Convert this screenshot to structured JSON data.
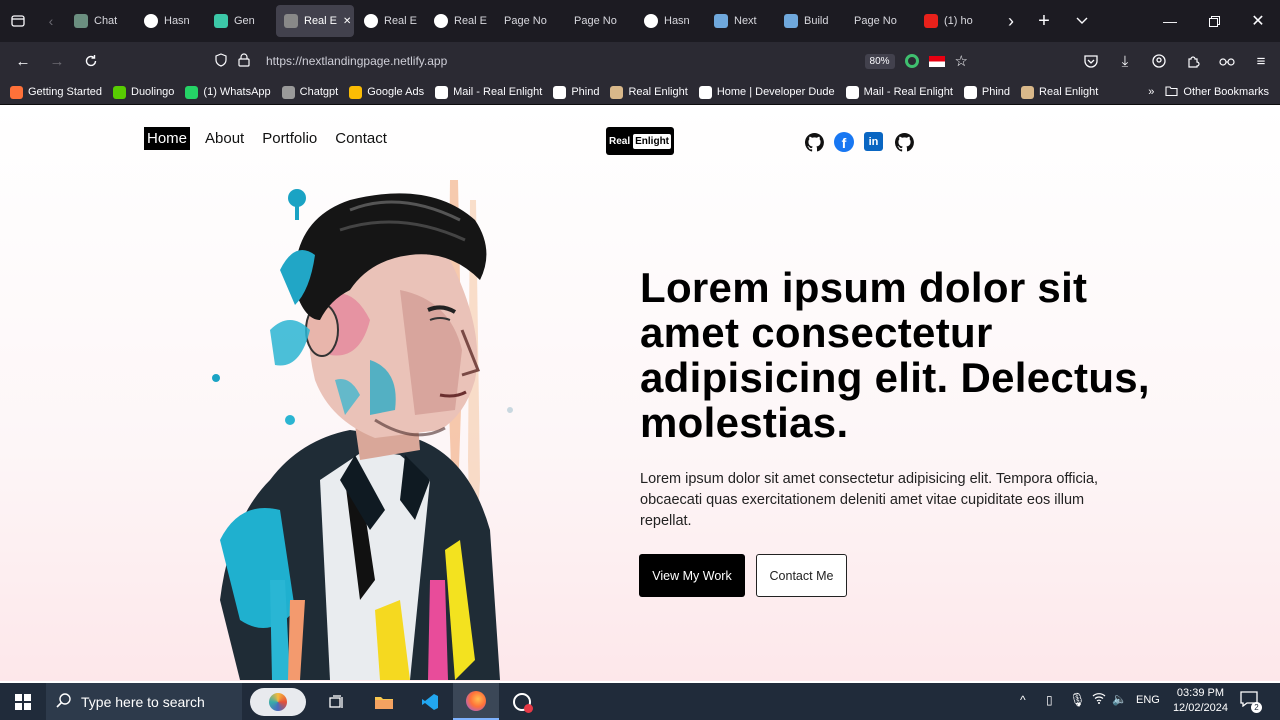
{
  "browser": {
    "tabs": [
      {
        "label": "Chat",
        "favicon_color": "#6b8f80"
      },
      {
        "label": "Hasn",
        "favicon_color": "#ffffff"
      },
      {
        "label": "Gen",
        "favicon_color": "#3cc8a8"
      },
      {
        "label": "Real E",
        "favicon_color": "#888888",
        "active": true
      },
      {
        "label": "Real E",
        "favicon_color": "#ffffff"
      },
      {
        "label": "Real E",
        "favicon_color": "#ffffff"
      },
      {
        "label": "Page No",
        "favicon_color": ""
      },
      {
        "label": "Page No",
        "favicon_color": ""
      },
      {
        "label": "Hasn",
        "favicon_color": "#ffffff"
      },
      {
        "label": "Next",
        "favicon_color": "#6fa8dc"
      },
      {
        "label": "Build",
        "favicon_color": "#6fa8dc"
      },
      {
        "label": "Page No",
        "favicon_color": ""
      },
      {
        "label": "(1) ho",
        "favicon_color": "#e8211b"
      }
    ],
    "url": "https://nextlandingpage.netlify.app",
    "zoom": "80%",
    "bookmarks": [
      {
        "label": "Getting Started",
        "color": "#ff7139"
      },
      {
        "label": "Duolingo",
        "color": "#58cc02"
      },
      {
        "label": "(1) WhatsApp",
        "color": "#25d366"
      },
      {
        "label": "Chatgpt",
        "color": "#9a9a9a"
      },
      {
        "label": "Google Ads",
        "color": "#fbbc04"
      },
      {
        "label": "Mail - Real Enlight",
        "color": "#ffffff"
      },
      {
        "label": "Phind",
        "color": "#ffffff"
      },
      {
        "label": "Real Enlight",
        "color": "#d9b88a"
      },
      {
        "label": "Home | Developer Dude",
        "color": "#ffffff"
      },
      {
        "label": "Mail - Real Enlight",
        "color": "#ffffff"
      },
      {
        "label": "Phind",
        "color": "#ffffff"
      },
      {
        "label": "Real Enlight",
        "color": "#d9b88a"
      }
    ],
    "other_bookmarks": "Other Bookmarks"
  },
  "site": {
    "nav": [
      {
        "label": "Home",
        "active": true
      },
      {
        "label": "About"
      },
      {
        "label": "Portfolio"
      },
      {
        "label": "Contact"
      }
    ],
    "logo": {
      "part1": "Real",
      "part2": "Enlight"
    },
    "socials": [
      "github-icon",
      "facebook-icon",
      "linkedin-icon",
      "github-icon"
    ],
    "hero": {
      "title": "Lorem ipsum dolor sit amet consectetur adipisicing elit. Delectus, molestias.",
      "text": "Lorem ipsum dolor sit amet consectetur adipisicing elit. Tempora officia, obcaecati quas exercitationem deleniti amet vitae cupiditate eos illum repellat.",
      "primary_button": "View My Work",
      "secondary_button": "Contact Me"
    }
  },
  "taskbar": {
    "search_placeholder": "Type here to search",
    "language": "ENG",
    "time": "03:39 PM",
    "date": "12/02/2024",
    "notifications": "2"
  },
  "colors": {
    "accent": "#000000",
    "browser_dark": "#1c1b22",
    "taskbar": "#202b3a"
  }
}
